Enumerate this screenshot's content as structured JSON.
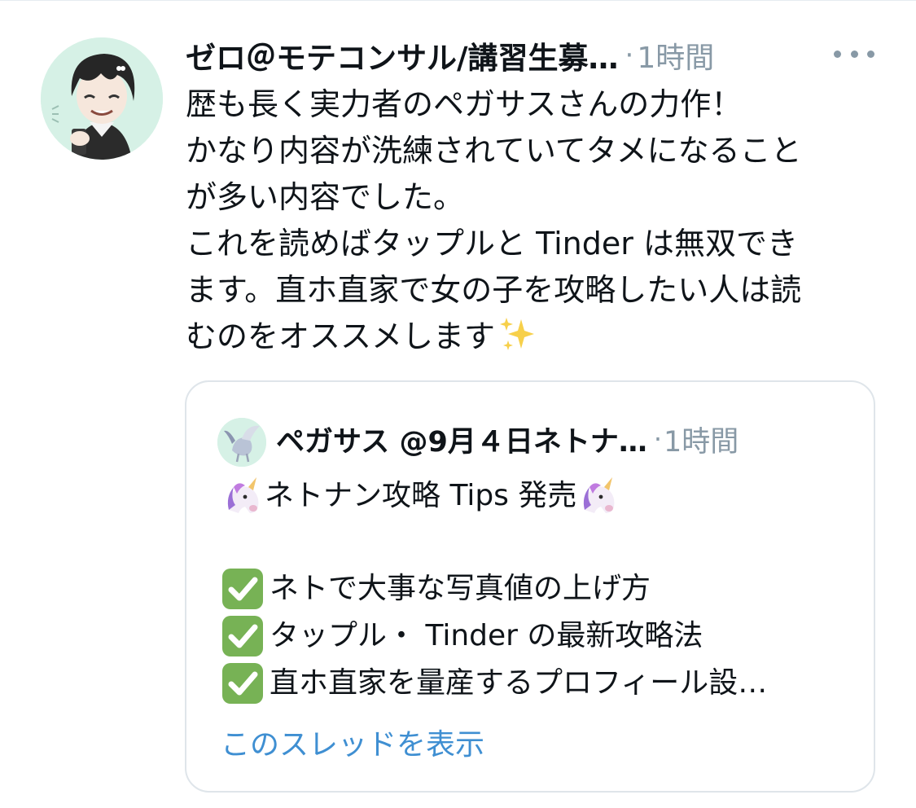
{
  "tweet": {
    "author_name": "ゼロ＠モテコンサル/講習生募…",
    "separator": "·",
    "time": "1時間",
    "more_icon": "more-horizontal-icon",
    "body_lines": [
      "歴も長く実力者のペガサスさんの力作！",
      "かなり内容が洗練されていてタメになること",
      "が多い内容でした。",
      "これを読めばタップルと Tinder は無双でき",
      "ます。直ホ直家で女の子を攻略したい人は読",
      "むのをオススメします"
    ],
    "body_end_emoji": "sparkles-emoji"
  },
  "quote": {
    "author_name": "ペガサス @9月４日ネトナ…",
    "separator": "·",
    "time": "1時間",
    "title": "ネトナン攻略 Tips 発売",
    "title_emoji": "unicorn-emoji",
    "check_emoji": "check-mark-button-emoji",
    "items": [
      "ネトで大事な写真値の上げ方",
      "タップル・ Tinder の最新攻略法",
      "直ホ直家を量産するプロフィール設…"
    ],
    "show_thread_label": "このスレッドを表示"
  },
  "colors": {
    "text": "#0f1419",
    "secondary_text": "#8899a6",
    "link": "#3f8fd2",
    "card_border": "#dfe5ea",
    "avatar_bg": "#d6f1e6"
  }
}
